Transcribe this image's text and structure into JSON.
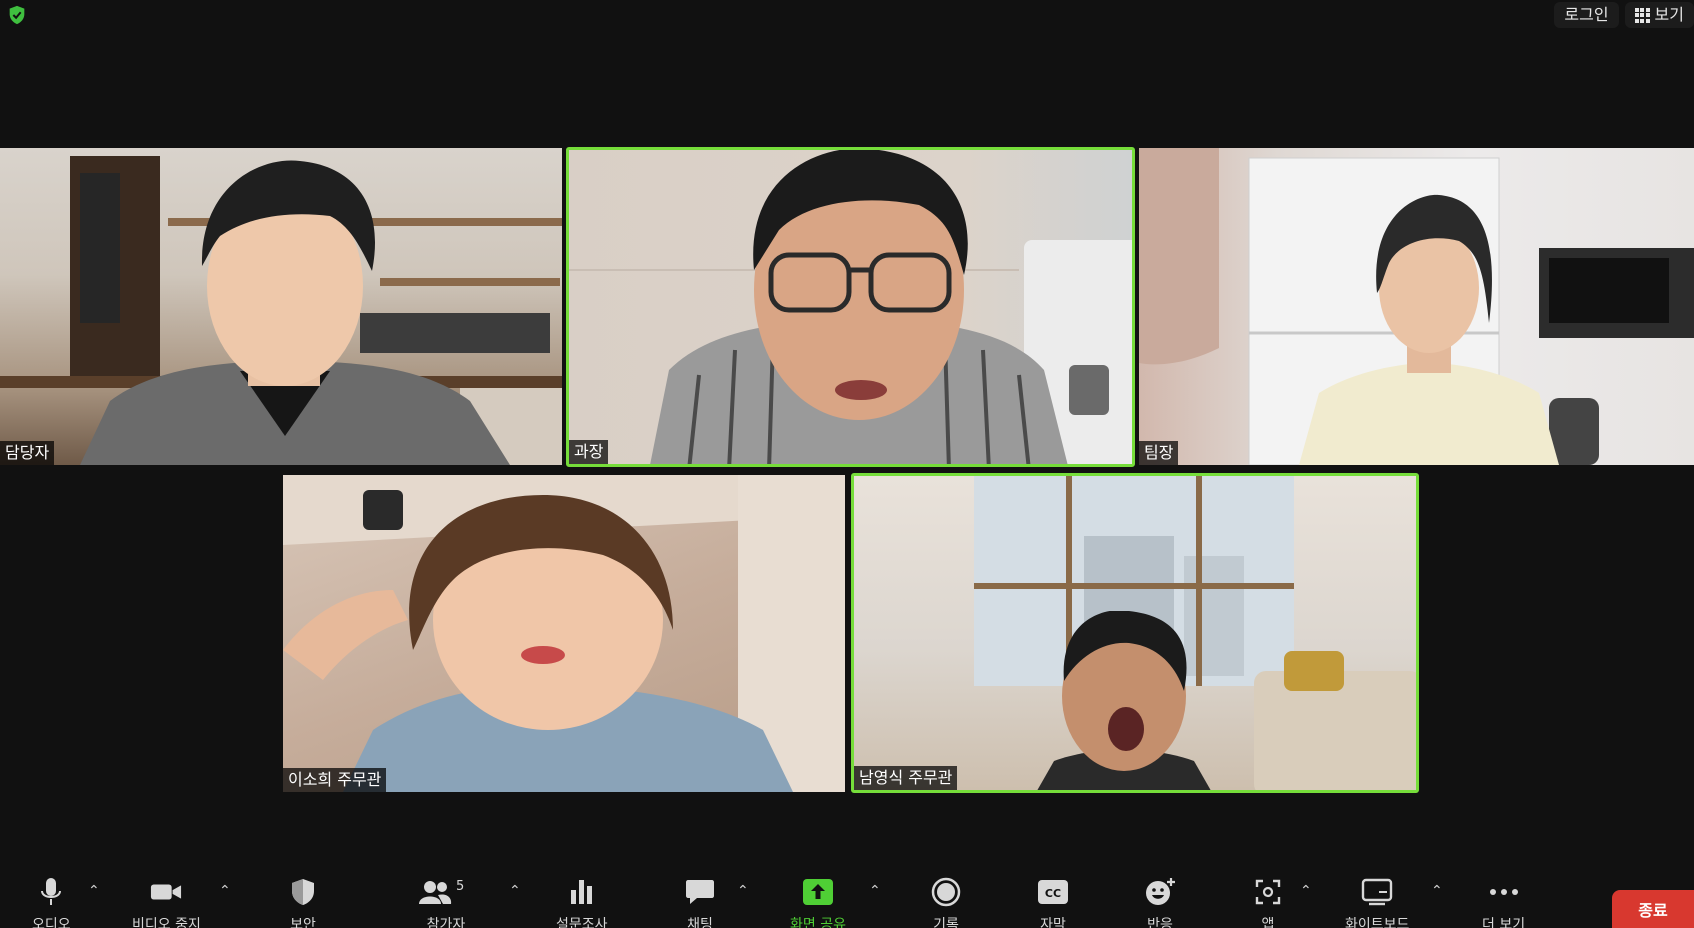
{
  "top": {
    "login_label": "로그인",
    "view_label": "보기"
  },
  "participants": [
    {
      "name": "담당자",
      "active": false
    },
    {
      "name": "과장",
      "active": true
    },
    {
      "name": "팀장",
      "active": false
    },
    {
      "name": "이소희 주무관",
      "active": false
    },
    {
      "name": "남영식 주무관",
      "active": true
    }
  ],
  "toolbar": {
    "audio": "오디오",
    "video": "비디오 중지",
    "security": "보안",
    "participants": "참가자",
    "participants_count": "5",
    "polls": "설문조사",
    "chat": "채팅",
    "share": "화면 공유",
    "record": "기록",
    "captions": "자막",
    "reactions": "반응",
    "apps": "앱",
    "whiteboard": "화이트보드",
    "more": "더 보기",
    "end": "종료"
  },
  "colors": {
    "active_border": "#76dd3a",
    "share_accent": "#4fcf35",
    "end_button": "#d8382f",
    "background": "#111111"
  }
}
